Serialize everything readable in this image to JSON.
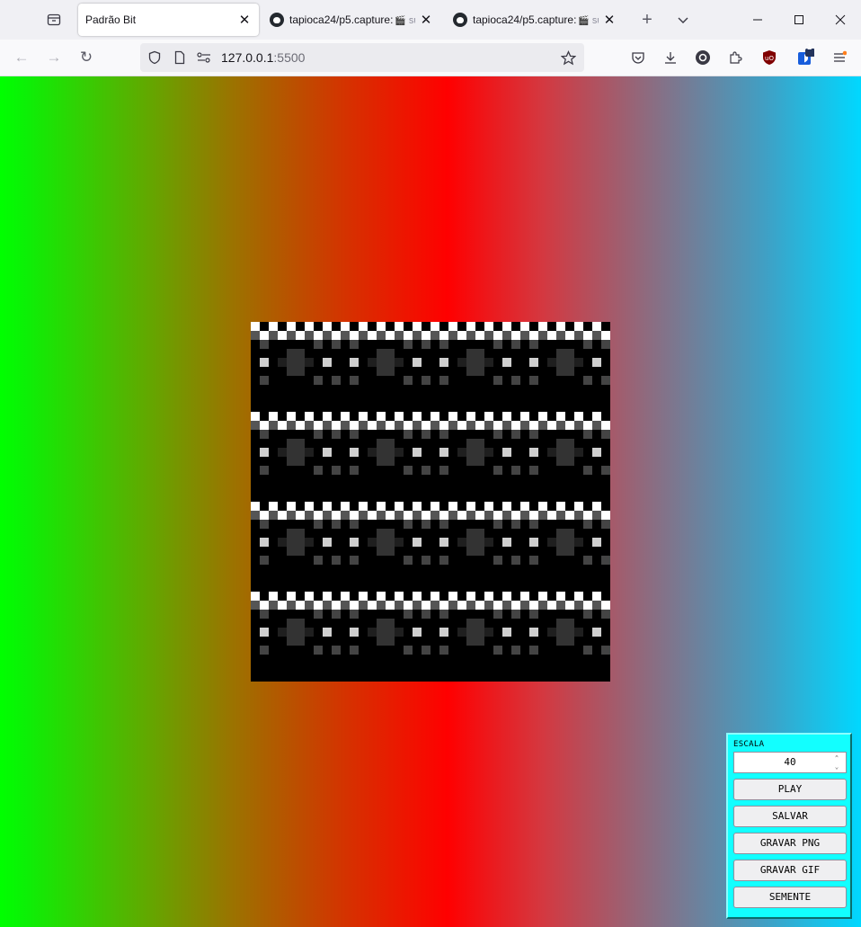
{
  "tabs": [
    {
      "title": "Padrão Bit",
      "active": true
    },
    {
      "title": "tapioca24/p5.capture:",
      "subtitle": "su",
      "active": false
    },
    {
      "title": "tapioca24/p5.capture:",
      "subtitle": "su",
      "active": false
    }
  ],
  "url": {
    "host": "127.0.0.1",
    "port": ":5500"
  },
  "extension_badge": "1",
  "colors": {
    "gradient_left": "#00ff00",
    "gradient_mid": "#ff0000",
    "gradient_right": "#00d8ff",
    "panel": "#12ffff"
  },
  "controls": {
    "scale_label": "ESCALA",
    "scale_value": "40",
    "buttons": [
      "PLAY",
      "SALVAR",
      "GRAVAR PNG",
      "GRAVAR GIF",
      "SEMENTE"
    ]
  }
}
